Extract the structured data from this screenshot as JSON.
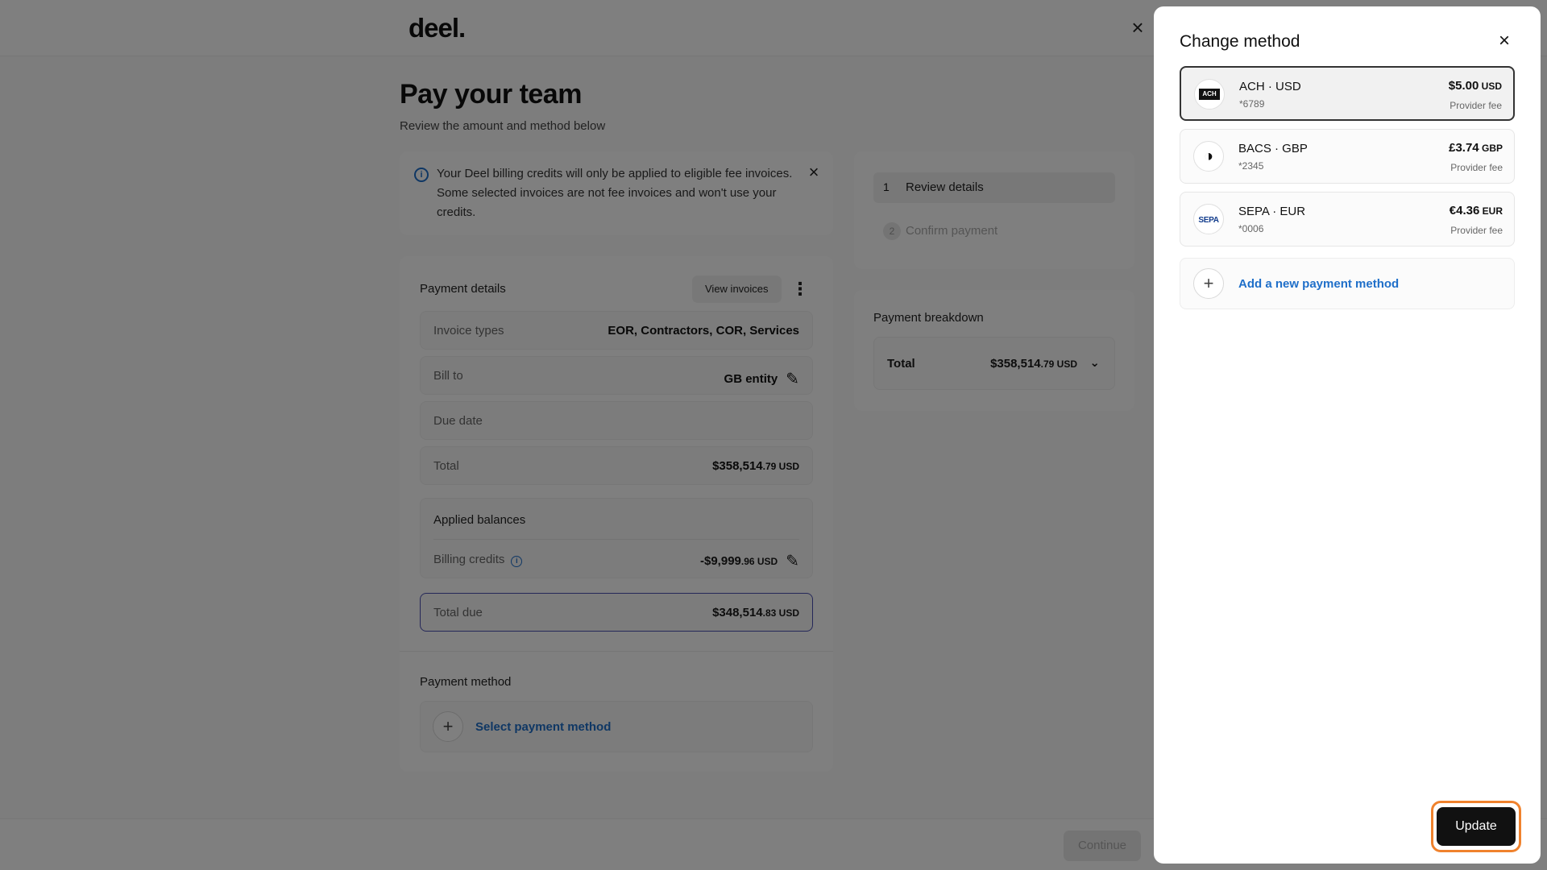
{
  "logo_text": "deel.",
  "page": {
    "title": "Pay your team",
    "subtitle": "Review the amount and method below"
  },
  "notice": {
    "text": "Your Deel billing credits will only be applied to eligible fee invoices. Some selected invoices are not fee invoices and won't use your credits."
  },
  "payment_details": {
    "title": "Payment details",
    "view_invoices_label": "View invoices",
    "rows": {
      "invoice_types": {
        "label": "Invoice types",
        "value": "EOR, Contractors, COR, Services"
      },
      "bill_to": {
        "label": "Bill to",
        "value": "GB entity"
      },
      "due_date": {
        "label": "Due date",
        "value": ""
      },
      "total": {
        "label": "Total",
        "amount": "$358,514",
        "cents": ".79 USD"
      }
    },
    "applied_balances": {
      "title": "Applied balances",
      "billing_credits_label": "Billing credits",
      "amount": "-$9,999",
      "cents": ".96 USD"
    },
    "total_due": {
      "label": "Total due",
      "amount": "$348,514",
      "cents": ".83 USD"
    },
    "payment_method_title": "Payment method",
    "select_payment_method_label": "Select payment method"
  },
  "steps": [
    {
      "number": "1",
      "label": "Review details",
      "active": true
    },
    {
      "number": "2",
      "label": "Confirm payment",
      "active": false
    }
  ],
  "breakdown": {
    "title": "Payment breakdown",
    "total_label": "Total",
    "amount": "$358,514",
    "cents": ".79 USD"
  },
  "footer": {
    "continue_label": "Continue"
  },
  "drawer": {
    "title": "Change method",
    "methods": [
      {
        "name": "ACH · USD",
        "account": "*6789",
        "fee_amount": "$5.00",
        "fee_currency": " USD",
        "fee_label": "Provider fee",
        "logo": "ACH",
        "selected": true
      },
      {
        "name": "BACS · GBP",
        "account": "*2345",
        "fee_amount": "£3.74",
        "fee_currency": " GBP",
        "fee_label": "Provider fee",
        "logo": "bacs-icon",
        "selected": false
      },
      {
        "name": "SEPA · EUR",
        "account": "*0006",
        "fee_amount": "€4.36",
        "fee_currency": " EUR",
        "fee_label": "Provider fee",
        "logo": "SEPA",
        "selected": false
      }
    ],
    "add_method_label": "Add a new payment method",
    "update_label": "Update"
  },
  "colors": {
    "accent_link": "#1f6fc9",
    "focus_ring": "#f0822d",
    "total_due_border": "#4b4fb3"
  }
}
